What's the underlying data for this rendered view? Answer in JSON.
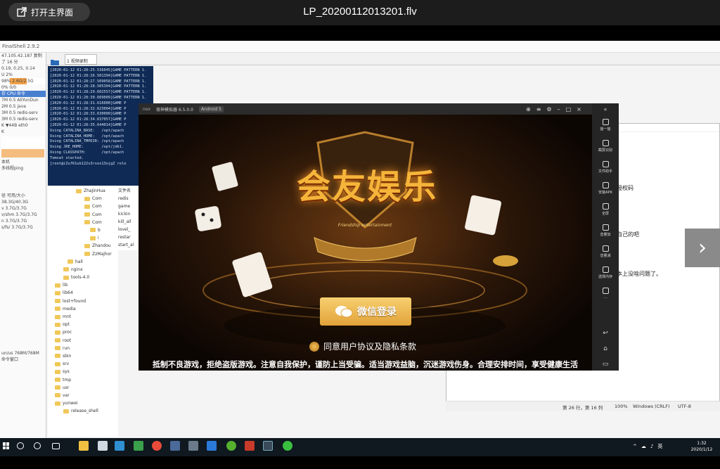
{
  "viewer": {
    "home_label": "打开主界面",
    "title": "LP_20200112013201.flv"
  },
  "finalshell": {
    "title": "FinalShell 2.9.2",
    "tab_label": "1 视频录制",
    "sidebar": [
      "47.105.42.187  复制",
      "了 16 分",
      "0.19, 0.25, 0.14",
      "U  2%",
      "98%  2.6G/2.5G",
      "0%  0/0",
      "存  CPU  命令",
      "7M  0.5 AliYunDun",
      "2M  0.5 java",
      "3M  0.5 redis-serv",
      "3M  0.5 redis-serv",
      "K  ▼44B  eth0",
      "K",
      "本机",
      "多线程ping",
      "径  可用/大小",
      "38.3G/40.3G",
      "v  3.7G/3.7G",
      "v/shm  3.7G/3.7G",
      "n  3.7G/3.7G",
      "s/fs/  3.7G/3.7G",
      "un/us  768M/768M",
      "命令窗口"
    ],
    "terminal_lines": [
      "[2020-01-12 01:28:25.536045]GAME PATTERN 1.",
      "[2020-01-12 01:28:26.501394]GAME PATTERN 1.",
      "[2020-01-12 01:28:27.509058]GAME PATTERN 1.",
      "[2020-01-12 01:28:28.505304]GAME PATTERN 1.",
      "[2020-01-12 01:28:29.602557]GAME PATTERN 1.",
      "[2020-01-12 01:28:30.609009]GAME PATTERN 1.",
      "[2020-01-12 01:28:31.616000]GAME P",
      "[2020-01-12 01:28:32.623004]GAME P",
      "[2020-01-12 01:28:33.630000]GAME P",
      "[2020-01-12 01:28:34.637057]GAME P",
      "[2020-01-12 01:28:35.644014]GAME P",
      "Using CATALINA_BASE:   /opt/apach",
      "Using CATALINA_HOME:   /opt/apach",
      "Using CATALINA_TMPDIR: /opt/apach",
      "Using JRE_HOME:        /opt/jdk1.",
      "Using CLASSPATH:       /opt/apach",
      "Tomcat started.",
      "[root@iZuf61uk122s3rsos13ojgZ rele"
    ],
    "tree": [
      "ZhaJinHua",
      "Com",
      "Com",
      "Com",
      "Com",
      "b",
      "i",
      "Zhandou",
      "ZzMajhor",
      "hall",
      "nginx",
      "tools-4.0",
      "lib",
      "lib64",
      "lost+found",
      "media",
      "mnt",
      "opt",
      "proc",
      "root",
      "run",
      "sbin",
      "srv",
      "sys",
      "tmp",
      "usr",
      "var",
      "yunwei",
      "release_shell"
    ],
    "files_header": "文件名",
    "files": [
      "redis",
      "game",
      "kickin",
      "kill_all",
      "lovel_",
      "restar",
      "start_al"
    ]
  },
  "notepad": {
    "lines": [
      "授权码",
      "自己的吧",
      "本上没啥问题了。"
    ],
    "status": {
      "position": "第 26 行，第 16 列",
      "zoom": "100%",
      "eol": "Windows (CRLF)",
      "encoding": "UTF-8"
    }
  },
  "emulator": {
    "brand": "nox",
    "name": "夜神模拟器 6.5.0.0",
    "android_badge": "Android 5",
    "side_buttons": [
      "摇一摇",
      "截屏识别",
      "文件助手",
      "安装APK",
      "全屏",
      "音量加",
      "音量减",
      "选择内存",
      "..."
    ],
    "game": {
      "title": "会友娱乐",
      "emblem_text": "Friendship entertainment",
      "wechat_login": "微信登录",
      "agree_text": "同意用户协议及隐私条款",
      "notice": "抵制不良游戏，拒绝盗版游戏。注意自我保护，谨防上当受骗。适当游戏益脑，沉迷游戏伤身。合理安排时间，享受健康生活"
    }
  },
  "taskbar": {
    "time": "1:32",
    "date": "2020/1/12",
    "ime": "英"
  },
  "colors": {
    "terminal_bg": "#0e2a55",
    "gold": "#f5b53a",
    "taskbar": "#101820"
  }
}
